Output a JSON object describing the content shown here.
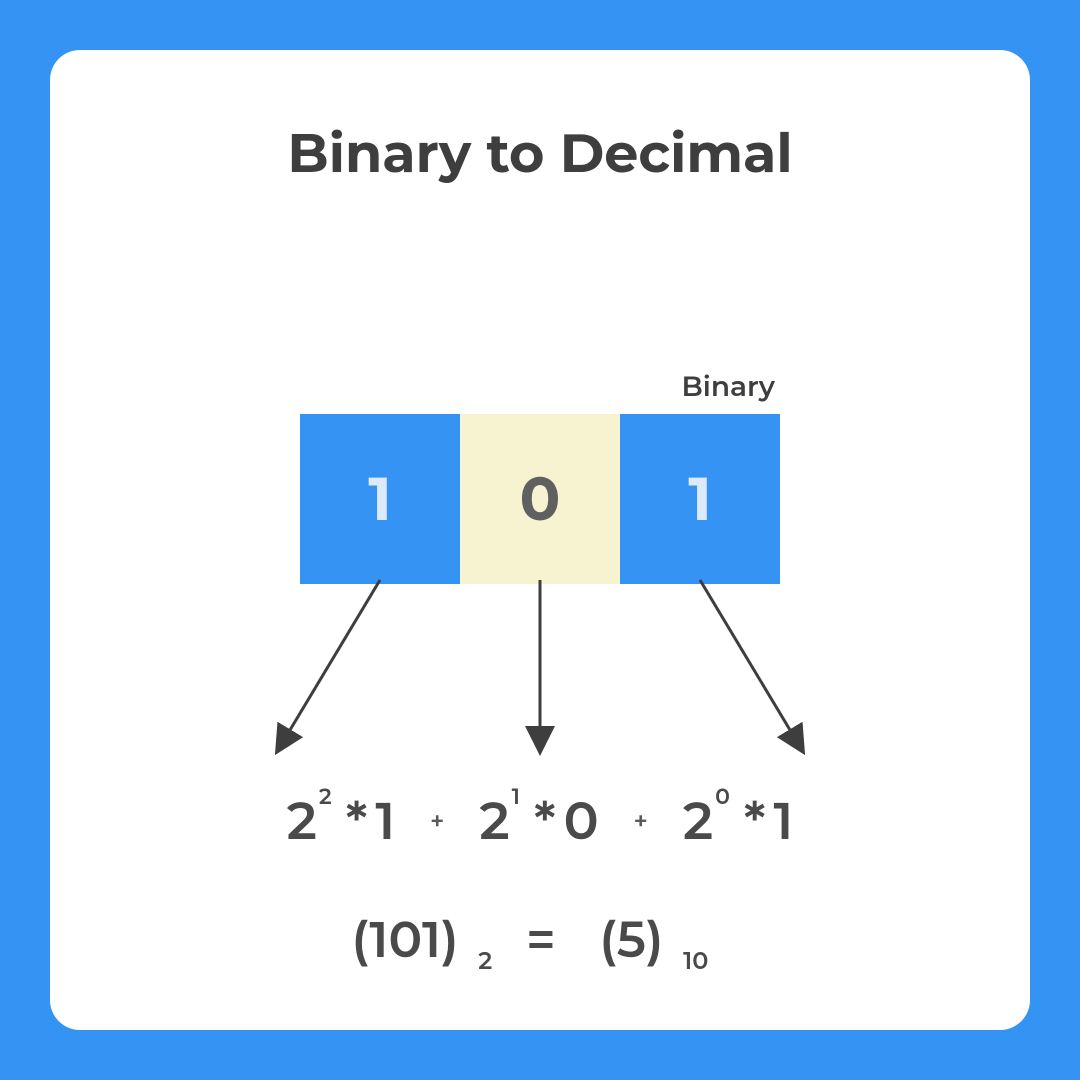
{
  "title": "Binary to Decimal",
  "binary_label": "Binary",
  "cells": {
    "c0": "1",
    "c1": "0",
    "c2": "1"
  },
  "expansion": {
    "term1": {
      "base": "2",
      "exp": "2",
      "digit": "1"
    },
    "term2": {
      "base": "2",
      "exp": "1",
      "digit": "0"
    },
    "term3": {
      "base": "2",
      "exp": "0",
      "digit": "1"
    },
    "plus": "+",
    "mult": "*"
  },
  "result": {
    "lhs_paren": "(101)",
    "lhs_sub": "2",
    "eq": "=",
    "rhs_paren": "(5)",
    "rhs_sub": "10"
  }
}
